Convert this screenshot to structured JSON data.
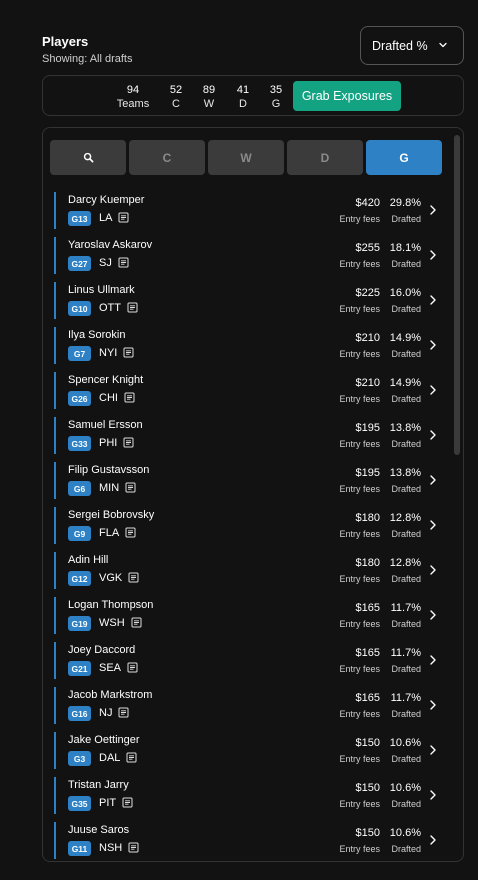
{
  "header": {
    "title": "Players",
    "subtitle": "Showing: All drafts"
  },
  "sort": {
    "label": "Drafted %"
  },
  "counts": [
    {
      "num": "94",
      "label": "Teams"
    },
    {
      "num": "52",
      "label": "C"
    },
    {
      "num": "89",
      "label": "W"
    },
    {
      "num": "41",
      "label": "D"
    },
    {
      "num": "35",
      "label": "G"
    }
  ],
  "grab_button": "Grab Exposures",
  "tabs": [
    {
      "label": "",
      "icon": "search-icon"
    },
    {
      "label": "C"
    },
    {
      "label": "W"
    },
    {
      "label": "D"
    },
    {
      "label": "G",
      "active": true
    }
  ],
  "row_labels": {
    "fee": "Entry fees",
    "pct": "Drafted"
  },
  "players": [
    {
      "name": "Darcy Kuemper",
      "badge": "G13",
      "team": "LA",
      "fee": "$420",
      "pct": "29.8%"
    },
    {
      "name": "Yaroslav Askarov",
      "badge": "G27",
      "team": "SJ",
      "fee": "$255",
      "pct": "18.1%"
    },
    {
      "name": "Linus Ullmark",
      "badge": "G10",
      "team": "OTT",
      "fee": "$225",
      "pct": "16.0%"
    },
    {
      "name": "Ilya Sorokin",
      "badge": "G7",
      "team": "NYI",
      "fee": "$210",
      "pct": "14.9%"
    },
    {
      "name": "Spencer Knight",
      "badge": "G26",
      "team": "CHI",
      "fee": "$210",
      "pct": "14.9%"
    },
    {
      "name": "Samuel Ersson",
      "badge": "G33",
      "team": "PHI",
      "fee": "$195",
      "pct": "13.8%"
    },
    {
      "name": "Filip Gustavsson",
      "badge": "G6",
      "team": "MIN",
      "fee": "$195",
      "pct": "13.8%"
    },
    {
      "name": "Sergei Bobrovsky",
      "badge": "G9",
      "team": "FLA",
      "fee": "$180",
      "pct": "12.8%"
    },
    {
      "name": "Adin Hill",
      "badge": "G12",
      "team": "VGK",
      "fee": "$180",
      "pct": "12.8%"
    },
    {
      "name": "Logan Thompson",
      "badge": "G19",
      "team": "WSH",
      "fee": "$165",
      "pct": "11.7%"
    },
    {
      "name": "Joey Daccord",
      "badge": "G21",
      "team": "SEA",
      "fee": "$165",
      "pct": "11.7%"
    },
    {
      "name": "Jacob Markstrom",
      "badge": "G16",
      "team": "NJ",
      "fee": "$165",
      "pct": "11.7%"
    },
    {
      "name": "Jake Oettinger",
      "badge": "G3",
      "team": "DAL",
      "fee": "$150",
      "pct": "10.6%"
    },
    {
      "name": "Tristan Jarry",
      "badge": "G35",
      "team": "PIT",
      "fee": "$150",
      "pct": "10.6%"
    },
    {
      "name": "Juuse Saros",
      "badge": "G11",
      "team": "NSH",
      "fee": "$150",
      "pct": "10.6%"
    }
  ]
}
